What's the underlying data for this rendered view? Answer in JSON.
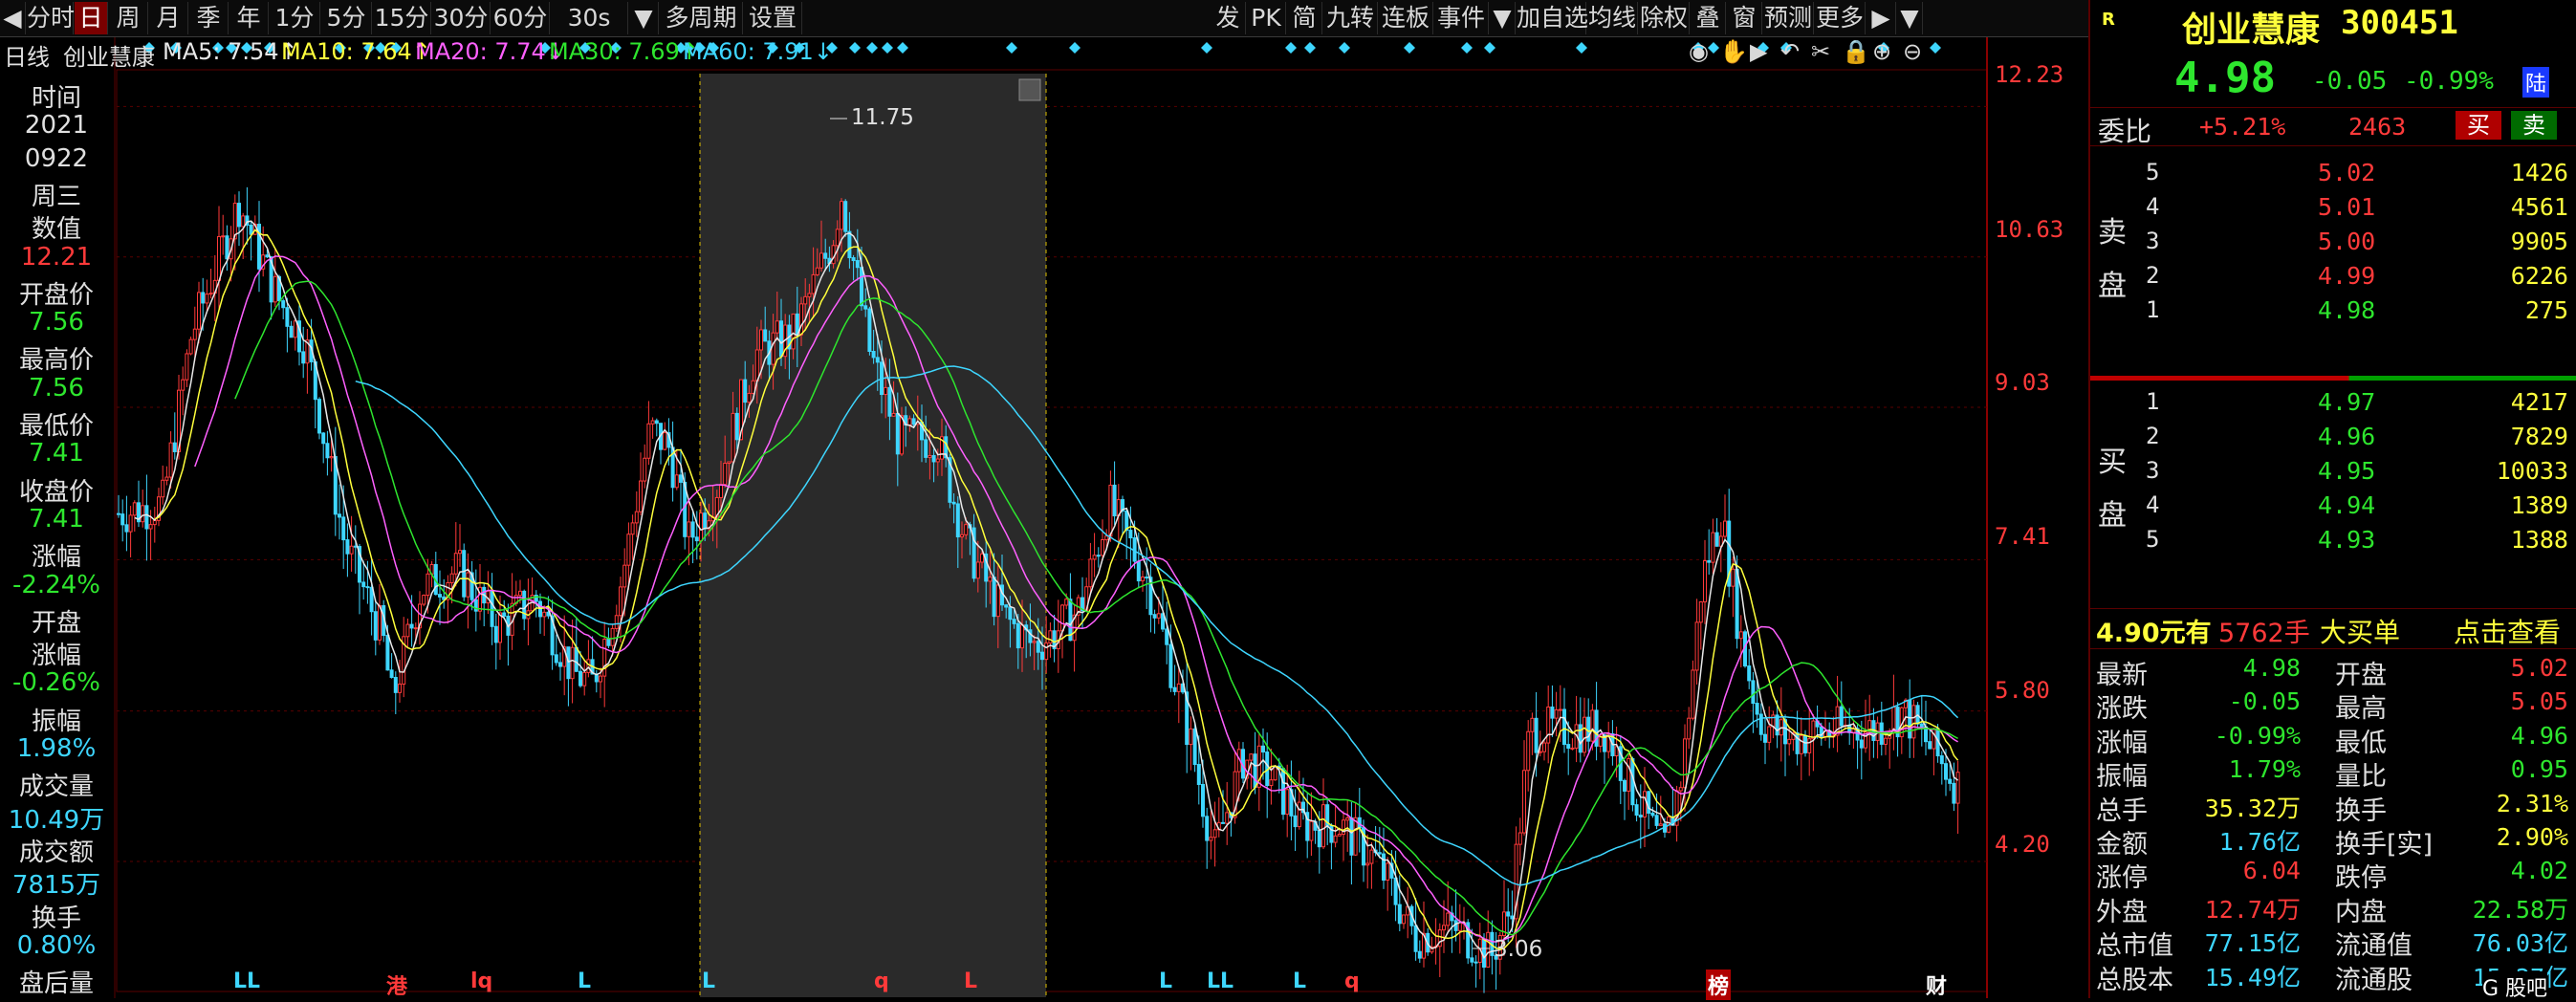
{
  "toolbar": {
    "left_items": [
      "◀",
      "分时",
      "日",
      "周",
      "月",
      "季",
      "年",
      "1分",
      "5分",
      "15分",
      "30分",
      "60分",
      "30s",
      "▼",
      "多周期",
      "设置"
    ],
    "active_index": 2,
    "right_items": [
      "发",
      "PK",
      "简",
      "九转",
      "连板",
      "事件",
      "▼",
      "加自选",
      "均线",
      "除权",
      "叠",
      "窗",
      "预测",
      "更多",
      "▶",
      "▼"
    ]
  },
  "chart_header": {
    "period": "日线",
    "stock_name": "创业慧康",
    "ma": [
      {
        "label": "MA5: 7.54",
        "arrow": "↑",
        "color": "#e8e8e8"
      },
      {
        "label": "MA10: 7.64",
        "arrow": "↑",
        "color": "#ffff3c"
      },
      {
        "label": "MA20: 7.74",
        "arrow": "↓",
        "color": "#ff60ff"
      },
      {
        "label": "MA30: 7.69",
        "arrow": "↑",
        "color": "#2ee62e"
      },
      {
        "label": "MA60: 7.91",
        "arrow": "↓",
        "color": "#3ed6ff"
      }
    ],
    "icons": [
      "eye-icon",
      "hand-icon",
      "play-icon",
      "undo-icon",
      "scissors-icon",
      "lock-icon",
      "zoom-in-icon",
      "zoom-out-icon"
    ],
    "icon_glyphs": [
      "◉",
      "✋",
      "▶",
      "↶",
      "✂",
      "🔒",
      "⊕",
      "⊖"
    ]
  },
  "left_info": [
    {
      "text": "时间",
      "color": "#e0e0e0"
    },
    {
      "text": "2021",
      "color": "#e0e0e0"
    },
    {
      "text": "0922",
      "color": "#e0e0e0"
    },
    {
      "text": "周三",
      "color": "#e0e0e0"
    },
    {
      "text": "数值",
      "color": "#e0e0e0"
    },
    {
      "text": "12.21",
      "color": "#ff3a3a"
    },
    {
      "text": "开盘价",
      "color": "#e0e0e0"
    },
    {
      "text": "7.56",
      "color": "#2ee62e"
    },
    {
      "text": "最高价",
      "color": "#e0e0e0"
    },
    {
      "text": "7.56",
      "color": "#2ee62e"
    },
    {
      "text": "最低价",
      "color": "#e0e0e0"
    },
    {
      "text": "7.41",
      "color": "#2ee62e"
    },
    {
      "text": "收盘价",
      "color": "#e0e0e0"
    },
    {
      "text": "7.41",
      "color": "#2ee62e"
    },
    {
      "text": "涨幅",
      "color": "#e0e0e0"
    },
    {
      "text": "-2.24%",
      "color": "#2ee62e"
    },
    {
      "text": "开盘",
      "color": "#e0e0e0"
    },
    {
      "text": "涨幅",
      "color": "#e0e0e0"
    },
    {
      "text": "-0.26%",
      "color": "#2ee62e"
    },
    {
      "text": "振幅",
      "color": "#e0e0e0"
    },
    {
      "text": "1.98%",
      "color": "#3ed6ff"
    },
    {
      "text": "成交量",
      "color": "#e0e0e0"
    },
    {
      "text": "10.49万",
      "color": "#3ed6ff"
    },
    {
      "text": "成交额",
      "color": "#e0e0e0"
    },
    {
      "text": "7815万",
      "color": "#3ed6ff"
    },
    {
      "text": "换手",
      "color": "#e0e0e0"
    },
    {
      "text": "0.80%",
      "color": "#3ed6ff"
    },
    {
      "text": "盘后量",
      "color": "#e0e0e0"
    }
  ],
  "price_axis": [
    "12.23",
    "10.63",
    "9.03",
    "7.41",
    "5.80",
    "4.20"
  ],
  "annotations": {
    "high": "11.75",
    "low": "3.06"
  },
  "bottom_markers": [
    {
      "text": "LL",
      "color": "#3ed6ff"
    },
    {
      "text": "港",
      "color": "#ff3a3a"
    },
    {
      "text": "lq",
      "color": "#ff3a3a"
    },
    {
      "text": "L",
      "color": "#3ed6ff"
    },
    {
      "text": "L",
      "color": "#3ed6ff"
    },
    {
      "text": "q",
      "color": "#ff3a3a"
    },
    {
      "text": "L",
      "color": "#ff3a3a"
    },
    {
      "text": "L",
      "color": "#3ed6ff"
    },
    {
      "text": "LL",
      "color": "#3ed6ff"
    },
    {
      "text": "L",
      "color": "#3ed6ff"
    },
    {
      "text": "q",
      "color": "#ff3a3a"
    },
    {
      "text": "榜",
      "color": "#ff3a3a"
    },
    {
      "text": "财",
      "color": "#ffffff"
    }
  ],
  "quote": {
    "badge": "R",
    "name": "创业慧康",
    "code": "300451",
    "price": "4.98",
    "change": "-0.05",
    "change_pct": "-0.99%",
    "exchange_tag": "陆",
    "weibi_label": "委比",
    "weibi_pct": "+5.21%",
    "weibi_diff": "2463",
    "buy_btn": "买",
    "sell_btn": "卖"
  },
  "sell_label": [
    "卖",
    "盘"
  ],
  "buy_label": [
    "买",
    "盘"
  ],
  "sell_orders": [
    {
      "level": "5",
      "price": "5.02",
      "volume": "1426"
    },
    {
      "level": "4",
      "price": "5.01",
      "volume": "4561"
    },
    {
      "level": "3",
      "price": "5.00",
      "volume": "9905"
    },
    {
      "level": "2",
      "price": "4.99",
      "volume": "6226"
    },
    {
      "level": "1",
      "price": "4.98",
      "volume": "275"
    }
  ],
  "buy_orders": [
    {
      "level": "1",
      "price": "4.97",
      "volume": "4217"
    },
    {
      "level": "2",
      "price": "4.96",
      "volume": "7829"
    },
    {
      "level": "3",
      "price": "4.95",
      "volume": "10033"
    },
    {
      "level": "4",
      "price": "4.94",
      "volume": "1389"
    },
    {
      "level": "5",
      "price": "4.93",
      "volume": "1388"
    }
  ],
  "big_order": {
    "price_text": "4.90元有",
    "volume_text": "5762手",
    "label": "大买单",
    "action": "点击查看"
  },
  "stats": [
    {
      "l1": "最新",
      "v1": "4.98",
      "c1": "#2ee62e",
      "l2": "开盘",
      "v2": "5.02",
      "c2": "#ff3a3a"
    },
    {
      "l1": "涨跌",
      "v1": "-0.05",
      "c1": "#2ee62e",
      "l2": "最高",
      "v2": "5.05",
      "c2": "#ff3a3a"
    },
    {
      "l1": "涨幅",
      "v1": "-0.99%",
      "c1": "#2ee62e",
      "l2": "最低",
      "v2": "4.96",
      "c2": "#2ee62e"
    },
    {
      "l1": "振幅",
      "v1": "1.79%",
      "c1": "#2ee62e",
      "l2": "量比",
      "v2": "0.95",
      "c2": "#2ee62e"
    },
    {
      "l1": "总手",
      "v1": "35.32万",
      "c1": "#ffff3c",
      "l2": "换手",
      "v2": "2.31%",
      "c2": "#ffff3c"
    },
    {
      "l1": "金额",
      "v1": "1.76亿",
      "c1": "#3ed6ff",
      "l2": "换手[实]",
      "v2": "2.90%",
      "c2": "#ffff3c"
    },
    {
      "l1": "涨停",
      "v1": "6.04",
      "c1": "#ff3a3a",
      "l2": "跌停",
      "v2": "4.02",
      "c2": "#2ee62e"
    },
    {
      "l1": "外盘",
      "v1": "12.74万",
      "c1": "#ff3a3a",
      "l2": "内盘",
      "v2": "22.58万",
      "c2": "#2ee62e"
    },
    {
      "l1": "总市值",
      "v1": "77.15亿",
      "c1": "#3ed6ff",
      "l2": "流通值",
      "v2": "76.03亿",
      "c2": "#3ed6ff"
    },
    {
      "l1": "总股本",
      "v1": "15.49亿",
      "c1": "#3ed6ff",
      "l2": "流通股",
      "v2": "15.27亿",
      "c2": "#3ed6ff"
    }
  ],
  "watermark": "G 股吧"
}
